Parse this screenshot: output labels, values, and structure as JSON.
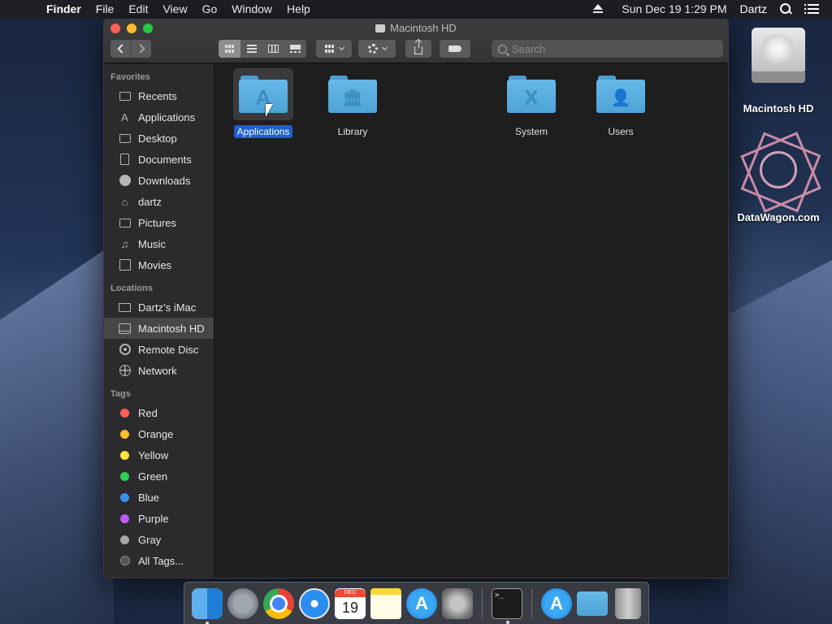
{
  "menubar": {
    "apple": "",
    "items": [
      "Finder",
      "File",
      "Edit",
      "View",
      "Go",
      "Window",
      "Help"
    ],
    "clock": "Sun Dec 19  1:29 PM",
    "user": "Dartz"
  },
  "window": {
    "title": "Macintosh HD",
    "search_placeholder": "Search"
  },
  "sidebar": {
    "favorites_header": "Favorites",
    "favorites": [
      "Recents",
      "Applications",
      "Desktop",
      "Documents",
      "Downloads",
      "dartz",
      "Pictures",
      "Music",
      "Movies"
    ],
    "locations_header": "Locations",
    "locations": [
      "Dartz’s iMac",
      "Macintosh HD",
      "Remote Disc",
      "Network"
    ],
    "selected_location": "Macintosh HD",
    "tags_header": "Tags",
    "tags": [
      {
        "name": "Red",
        "color": "#fe5f57"
      },
      {
        "name": "Orange",
        "color": "#febc2e"
      },
      {
        "name": "Yellow",
        "color": "#fee33a"
      },
      {
        "name": "Green",
        "color": "#2fd158"
      },
      {
        "name": "Blue",
        "color": "#3b8ff0"
      },
      {
        "name": "Purple",
        "color": "#bf5af2"
      },
      {
        "name": "Gray",
        "color": "#a8a8aa"
      }
    ],
    "all_tags": "All Tags..."
  },
  "content": {
    "items": [
      {
        "label": "Applications",
        "glyph": "A",
        "selected": true
      },
      {
        "label": "Library",
        "glyph": "🏛",
        "selected": false
      },
      {
        "label": "System",
        "glyph": "X",
        "selected": false
      },
      {
        "label": "Users",
        "glyph": "👤",
        "selected": false
      }
    ]
  },
  "desktop": {
    "icons": [
      "Macintosh HD",
      "DataWagon.com"
    ]
  },
  "dock": {
    "calendar_month": "DEC",
    "calendar_day": "19",
    "terminal_prompt": ">_",
    "appstore_glyph": "A",
    "applications_glyph": "A"
  },
  "colors": {
    "selection": "#1c5fd1",
    "folder": "#5aaee2"
  }
}
